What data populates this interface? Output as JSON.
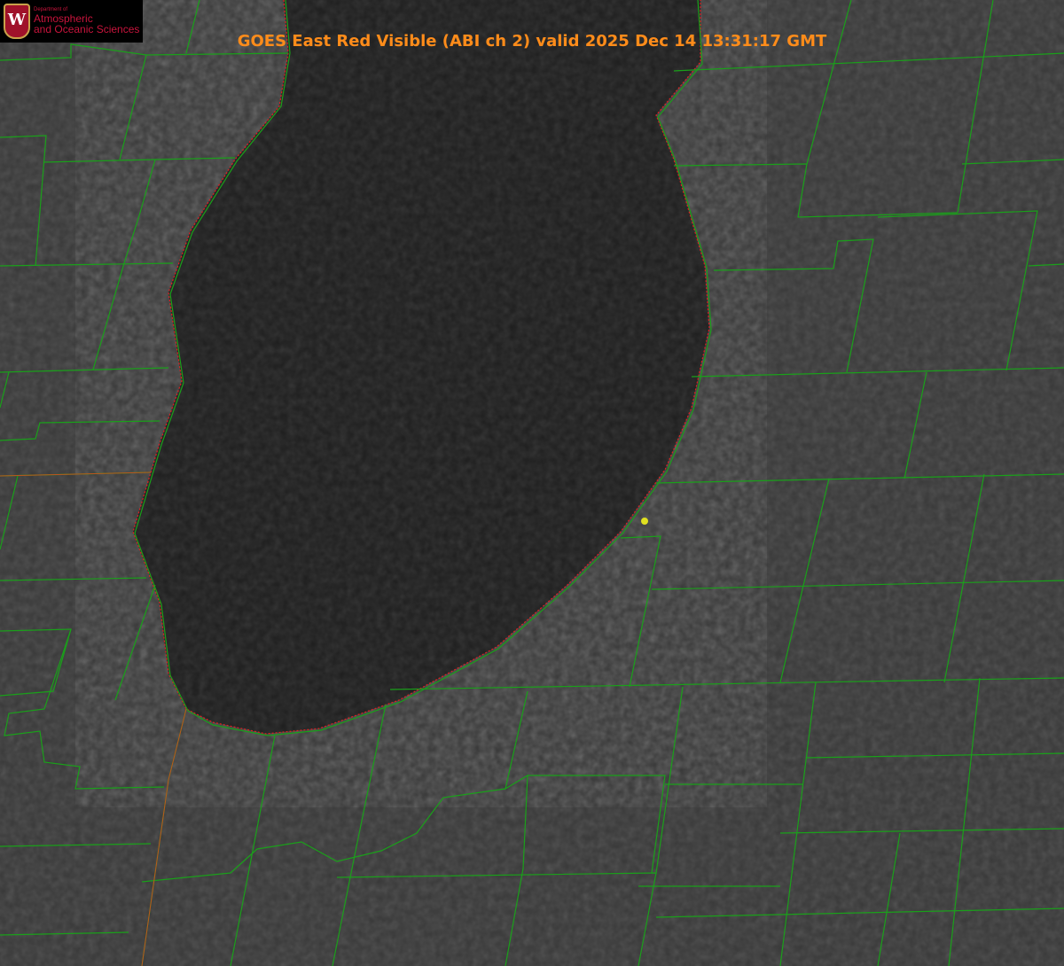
{
  "title": "GOES East Red Visible (ABI ch 2) valid 2025 Dec 14 13:31:17 GMT",
  "logo": {
    "crest_letter": "W",
    "line1": "Department of",
    "line2": "Atmospheric",
    "line3": "and Oceanic Sciences"
  },
  "colors": {
    "borders": "#1aa01a",
    "coastline": "#e02020",
    "marker": "#e0e020",
    "title": "#ff8c1a"
  }
}
